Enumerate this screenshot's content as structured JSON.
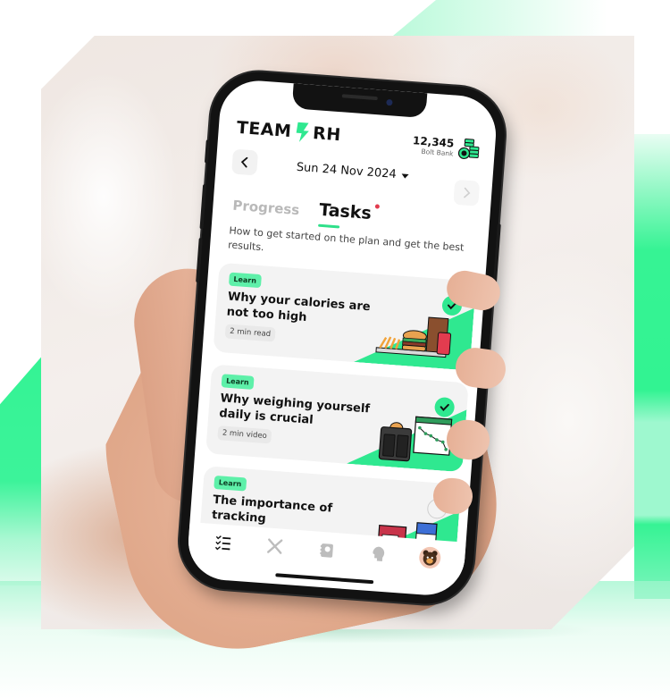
{
  "app": {
    "logo_left": "TEAM",
    "logo_right": "RH",
    "brand_color": "#2fe890",
    "bolt_bank": {
      "count": "12,345",
      "label": "Bolt Bank",
      "icon": "coins-icon"
    }
  },
  "date_nav": {
    "prev_icon": "chevron-left-icon",
    "date": "Sun 24 Nov 2024",
    "dropdown_icon": "caret-down-icon",
    "next_icon": "chevron-right-icon",
    "next_disabled": true
  },
  "tabs": [
    {
      "label": "Progress",
      "active": false
    },
    {
      "label": "Tasks",
      "active": true,
      "notification_dot": true
    }
  ],
  "intro": "How to get started on the plan and get the best results.",
  "tasks": [
    {
      "badge": "Learn",
      "title": "Why your calories are not too high",
      "meta": "2 min read",
      "completed": true,
      "illustration": "fast-food-illustration"
    },
    {
      "badge": "Learn",
      "title": "Why weighing yourself daily is crucial",
      "meta": "2 min video",
      "completed": true,
      "illustration": "scale-chart-illustration"
    },
    {
      "badge": "Learn",
      "title": "The importance of tracking",
      "meta": "",
      "completed": false,
      "illustration": "groceries-illustration"
    }
  ],
  "bottom_nav": [
    {
      "name": "tasks",
      "icon": "checklist-icon",
      "active": true
    },
    {
      "name": "meals",
      "icon": "fork-knife-icon",
      "active": false
    },
    {
      "name": "recipes",
      "icon": "recipe-book-icon",
      "active": false
    },
    {
      "name": "mindset",
      "icon": "head-icon",
      "active": false
    },
    {
      "name": "profile",
      "icon": "bear-avatar-icon",
      "active": false
    }
  ]
}
